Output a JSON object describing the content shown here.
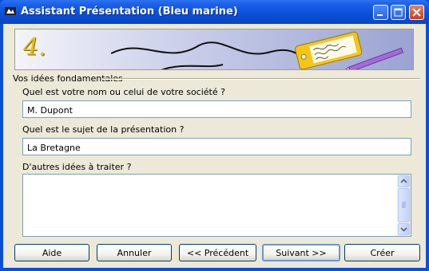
{
  "window": {
    "title": "Assistant Présentation (Bleu marine)"
  },
  "banner": {
    "step_label": "4."
  },
  "section": {
    "label": "Vos idées fondamentales"
  },
  "fields": {
    "name": {
      "label": "Quel est votre nom ou celui de votre société ?",
      "value": "M. Dupont"
    },
    "subject": {
      "label": "Quel est le sujet de la présentation ?",
      "value": "La Bretagne"
    },
    "other": {
      "label": "D'autres idées à traiter ?",
      "value": ""
    }
  },
  "buttons": {
    "help": "Aide",
    "cancel": "Annuler",
    "previous": "<< Précédent",
    "next": "Suivant >>",
    "create": "Créer"
  },
  "colors": {
    "titlebar": "#0a4fd6",
    "client": "#ece9d8",
    "field_border": "#7f9db9",
    "tag": "#f5c518"
  },
  "icons": [
    "app-icon",
    "minimize-icon",
    "maximize-icon",
    "close-icon",
    "scroll-up-arrow-icon",
    "scroll-down-arrow-icon"
  ]
}
